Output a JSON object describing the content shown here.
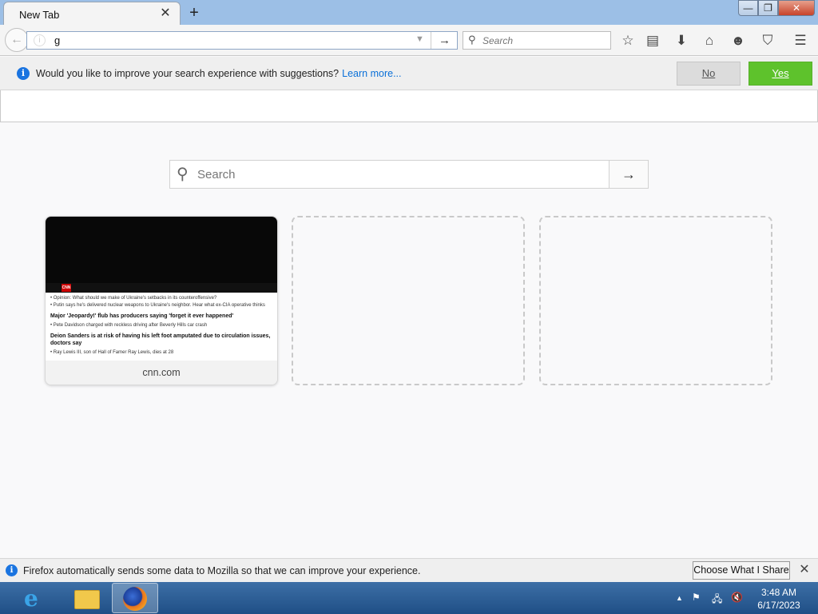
{
  "window": {
    "minimize_glyph": "—",
    "maximize_glyph": "❐",
    "close_glyph": "✕"
  },
  "tab": {
    "title": "New Tab",
    "close_glyph": "✕"
  },
  "newtab_glyph": "+",
  "navbar": {
    "url_value": "g",
    "go_glyph": "→",
    "search_placeholder": "Search",
    "icons": [
      "bookmark-star-icon",
      "reading-list-icon",
      "download-icon",
      "home-icon",
      "hello-icon",
      "pocket-icon",
      "menu-icon"
    ]
  },
  "suggestions_notice": {
    "text": "Would you like to improve your search experience with suggestions?",
    "link": "Learn more...",
    "no_label": "No",
    "yes_label": "Yes"
  },
  "content": {
    "search_placeholder": "Search",
    "go_glyph": "→",
    "tiles": [
      {
        "label": "cnn.com",
        "thumb_lines": [
          "• Opinion: What should we make of Ukraine's setbacks in its counteroffensive?",
          "• Putin says he's delivered nuclear weapons to Ukraine's neighbor. Hear what ex-CIA operative thinks",
          "Major 'Jeopardy!' flub has producers saying 'forget it ever happened'",
          "• Pete Davidson charged with reckless driving after Beverly Hills car crash",
          "Deion Sanders is at risk of having his left foot amputated due to circulation issues, doctors say",
          "• Ray Lewis III, son of Hall of Famer Ray Lewis, dies at 28"
        ]
      }
    ]
  },
  "data_notice": {
    "text": "Firefox automatically sends some data to Mozilla so that we can improve your experience.",
    "button": "Choose What I Share",
    "close_glyph": "✕"
  },
  "taskbar": {
    "time": "3:48 AM",
    "date": "6/17/2023"
  }
}
